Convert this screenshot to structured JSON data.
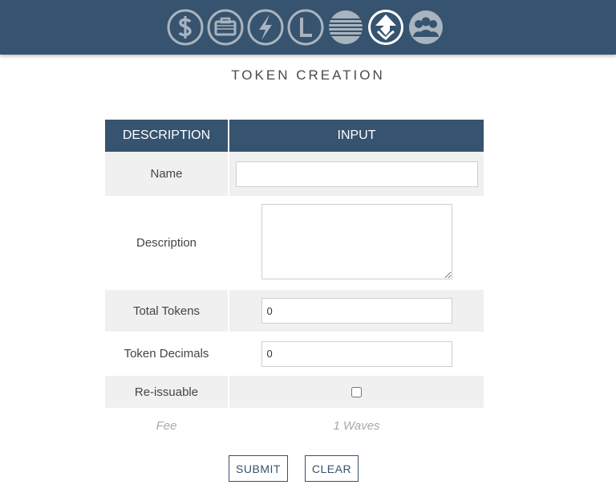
{
  "header": {
    "nav_icons": [
      {
        "name": "dollar-icon",
        "active": false
      },
      {
        "name": "wallet-icon",
        "active": false
      },
      {
        "name": "lightning-icon",
        "active": false
      },
      {
        "name": "lease-icon",
        "active": false
      },
      {
        "name": "stripes-icon",
        "active": false
      },
      {
        "name": "token-icon",
        "active": true
      },
      {
        "name": "community-icon",
        "active": false
      }
    ],
    "bar_color": "#36536f"
  },
  "page": {
    "title": "TOKEN CREATION"
  },
  "table": {
    "headers": {
      "description": "DESCRIPTION",
      "input": "INPUT"
    },
    "rows": {
      "name": {
        "label": "Name",
        "value": ""
      },
      "description": {
        "label": "Description",
        "value": ""
      },
      "total_tokens": {
        "label": "Total Tokens",
        "value": "0"
      },
      "token_decimals": {
        "label": "Token Decimals",
        "value": "0"
      },
      "reissuable": {
        "label": "Re-issuable",
        "checked": false
      },
      "fee": {
        "label": "Fee",
        "value": "1 Waves"
      }
    }
  },
  "buttons": {
    "submit": "SUBMIT",
    "clear": "CLEAR"
  }
}
